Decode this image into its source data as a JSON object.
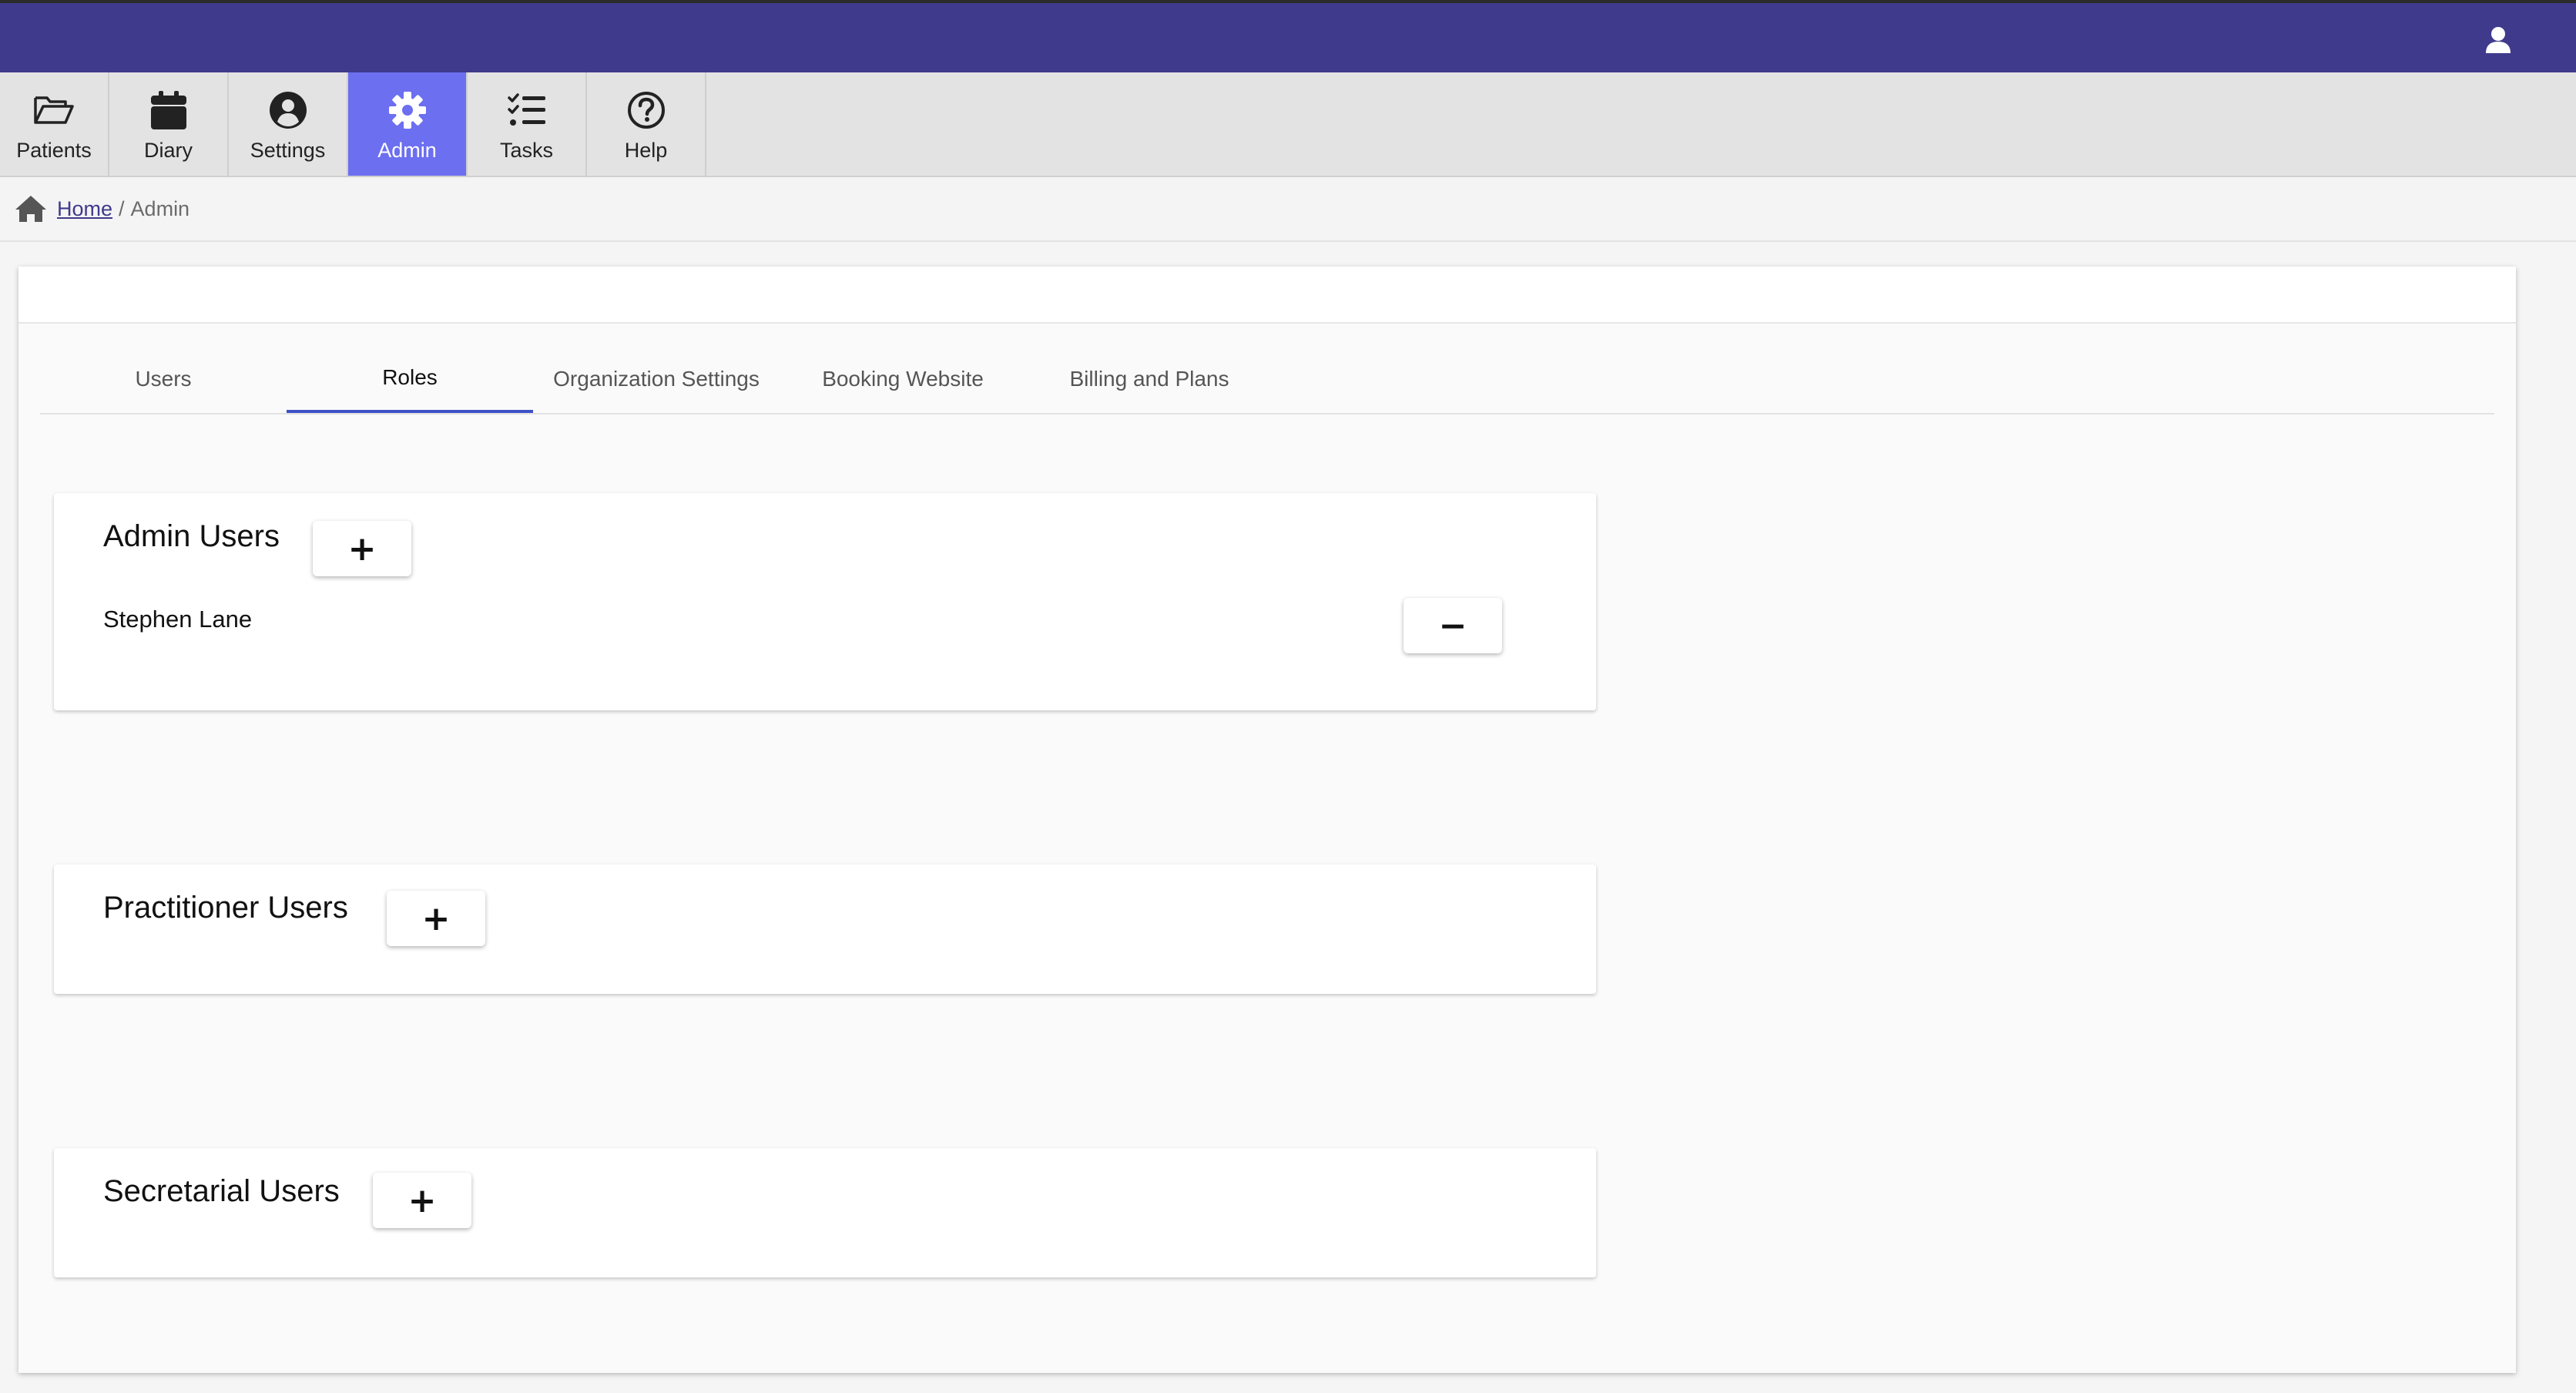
{
  "nav": {
    "items": [
      {
        "label": "Patients",
        "icon": "folder-open-icon",
        "active": false
      },
      {
        "label": "Diary",
        "icon": "calendar-icon",
        "active": false
      },
      {
        "label": "Settings",
        "icon": "user-circle-icon",
        "active": false
      },
      {
        "label": "Admin",
        "icon": "gear-icon",
        "active": true
      },
      {
        "label": "Tasks",
        "icon": "task-list-icon",
        "active": false
      },
      {
        "label": "Help",
        "icon": "question-circle-icon",
        "active": false
      }
    ]
  },
  "breadcrumb": {
    "home_label": "Home",
    "separator": "/",
    "current": "Admin"
  },
  "tabs": [
    {
      "label": "Users",
      "active": false
    },
    {
      "label": "Roles",
      "active": true
    },
    {
      "label": "Organization Settings",
      "active": false
    },
    {
      "label": "Booking Website",
      "active": false
    },
    {
      "label": "Billing and Plans",
      "active": false
    }
  ],
  "roles": {
    "admin": {
      "title": "Admin Users",
      "add_label": "+",
      "members": [
        {
          "name": "Stephen Lane",
          "remove_label": "−"
        }
      ]
    },
    "practitioner": {
      "title": "Practitioner Users",
      "add_label": "+"
    },
    "secretarial": {
      "title": "Secretarial Users",
      "add_label": "+"
    }
  },
  "colors": {
    "topbar": "#3f3a8c",
    "active_nav": "#6c6ff0",
    "active_tab_underline": "#3f51c5"
  }
}
